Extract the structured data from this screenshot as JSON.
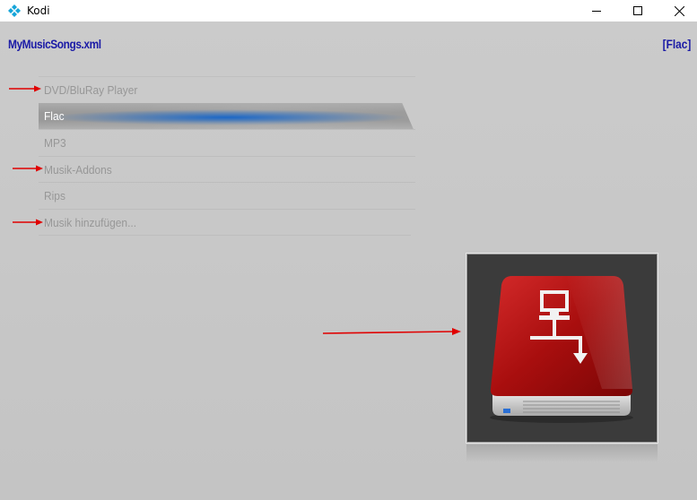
{
  "window": {
    "title": "Kodi",
    "icon": "kodi-logo-icon",
    "controls": {
      "minimize": "minimize-icon",
      "maximize": "maximize-icon",
      "close": "close-icon"
    }
  },
  "header": {
    "path": "MyMusicSongs.xml",
    "context": "[Flac]"
  },
  "menu": {
    "items": [
      {
        "label": "DVD/BluRay Player",
        "selected": false,
        "annotated": true
      },
      {
        "label": "Flac",
        "selected": true,
        "annotated": false
      },
      {
        "label": "MP3",
        "selected": false,
        "annotated": false
      },
      {
        "label": "Musik-Addons",
        "selected": false,
        "annotated": true
      },
      {
        "label": "Rips",
        "selected": false,
        "annotated": false
      },
      {
        "label": "Musik hinzufügen...",
        "selected": false,
        "annotated": true
      }
    ]
  },
  "preview": {
    "icon": "network-drive-icon",
    "annotated": true
  },
  "colors": {
    "accent": "#1b1ba6",
    "selection": "#1464c8",
    "annotation_arrow": "#e00000",
    "drive_red": "#b31616",
    "text_muted": "#979797"
  }
}
